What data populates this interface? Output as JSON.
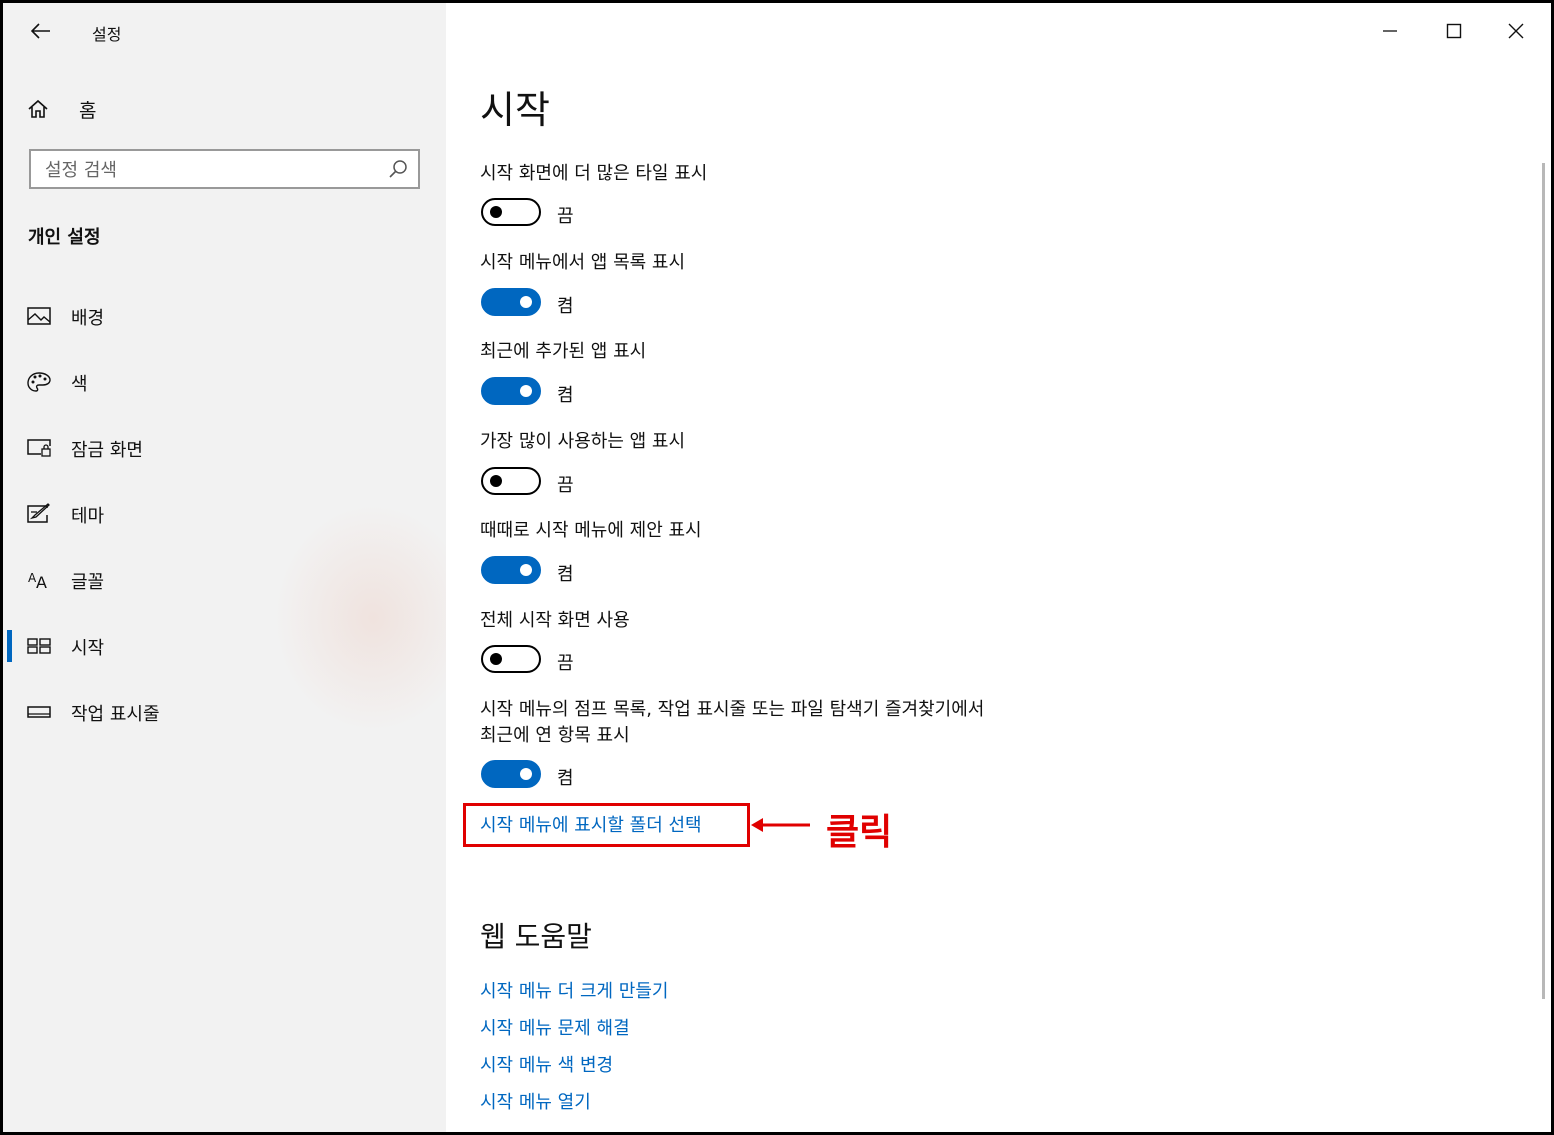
{
  "window": {
    "title": "설정"
  },
  "sidebar": {
    "home_label": "홈",
    "search_placeholder": "설정 검색",
    "section_title": "개인 설정",
    "items": [
      {
        "label": "배경",
        "icon": "picture-icon",
        "active": false
      },
      {
        "label": "색",
        "icon": "palette-icon",
        "active": false
      },
      {
        "label": "잠금 화면",
        "icon": "lock-screen-icon",
        "active": false
      },
      {
        "label": "테마",
        "icon": "theme-icon",
        "active": false
      },
      {
        "label": "글꼴",
        "icon": "font-icon",
        "active": false
      },
      {
        "label": "시작",
        "icon": "start-icon",
        "active": true
      },
      {
        "label": "작업 표시줄",
        "icon": "taskbar-icon",
        "active": false
      }
    ]
  },
  "main": {
    "title": "시작",
    "settings": [
      {
        "label": "시작 화면에 더 많은 타일 표시",
        "on": false,
        "state": "끔"
      },
      {
        "label": "시작 메뉴에서 앱 목록 표시",
        "on": true,
        "state": "켬"
      },
      {
        "label": "최근에 추가된 앱 표시",
        "on": true,
        "state": "켬"
      },
      {
        "label": "가장 많이 사용하는 앱 표시",
        "on": false,
        "state": "끔"
      },
      {
        "label": "때때로 시작 메뉴에 제안 표시",
        "on": true,
        "state": "켬"
      },
      {
        "label": "전체 시작 화면 사용",
        "on": false,
        "state": "끔"
      },
      {
        "label_line1": "시작 메뉴의 점프 목록, 작업 표시줄 또는 파일 탐색기 즐겨찾기에서",
        "label_line2": "최근에 연 항목 표시",
        "on": true,
        "state": "켬"
      }
    ],
    "folder_link": "시작 메뉴에 표시할 폴더 선택",
    "annotation": "클릭",
    "help_title": "웹 도움말",
    "help_links": [
      "시작 메뉴 더 크게 만들기",
      "시작 메뉴 문제 해결",
      "시작 메뉴 색 변경",
      "시작 메뉴 열기"
    ]
  },
  "colors": {
    "accent": "#0067c0",
    "annotation": "#e00000",
    "sidebar_bg": "#f2f2f2"
  }
}
